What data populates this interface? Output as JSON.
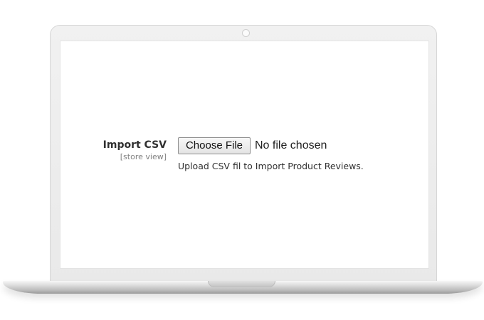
{
  "form": {
    "field_label": "Import CSV",
    "scope_label": "[store view]",
    "file_button_label": "Choose File",
    "file_status": "No file chosen",
    "note": "Upload CSV fil to Import Product Reviews."
  },
  "device": {
    "type": "laptop-mockup",
    "body_color": "#eeeeee",
    "screen_color": "#ffffff"
  }
}
